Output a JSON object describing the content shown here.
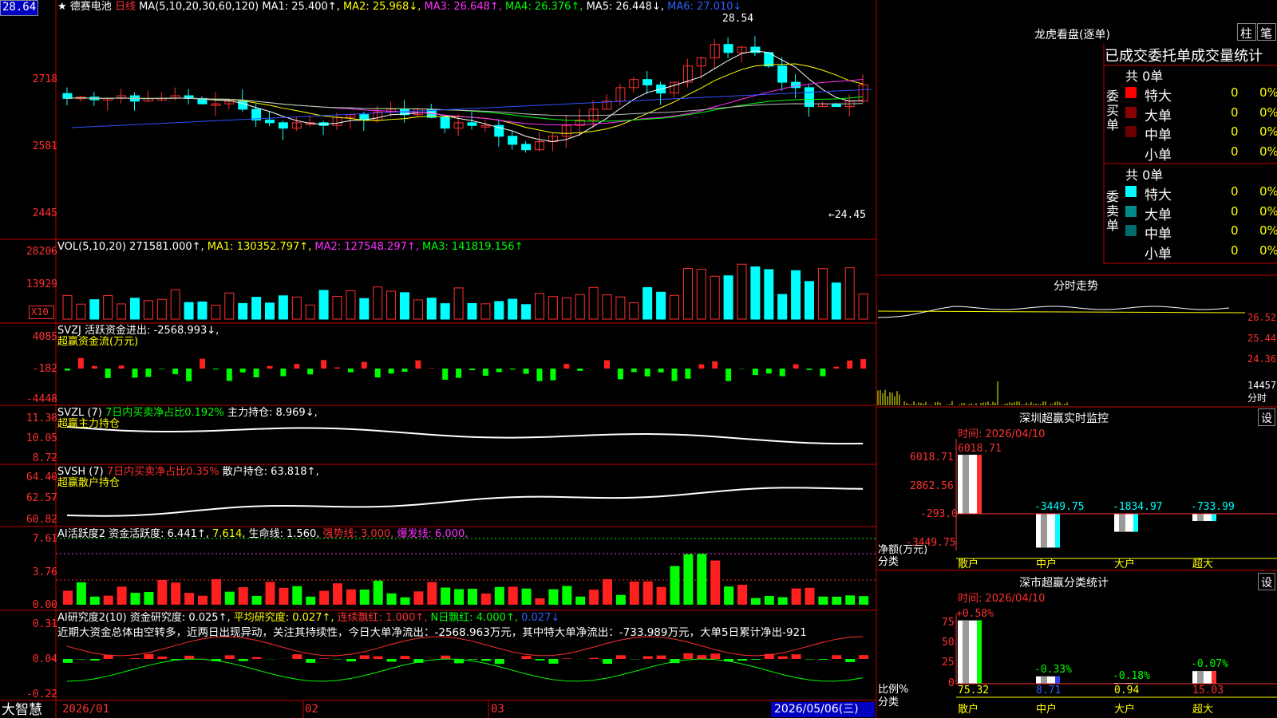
{
  "price_box": "28.64",
  "kline": {
    "header": [
      {
        "t": "★",
        "c": "wht"
      },
      {
        "t": "德赛电池",
        "c": "wht"
      },
      {
        "t": "日线",
        "c": "red"
      },
      {
        "t": "MA(5,10,20,30,60,120)",
        "c": "wht"
      },
      {
        "t": "MA1: 25.400↑,",
        "c": "wht"
      },
      {
        "t": "MA2: 25.968↓,",
        "c": "yel"
      },
      {
        "t": "MA3: 26.648↑,",
        "c": "mag"
      },
      {
        "t": "MA4: 26.376↑,",
        "c": "grn"
      },
      {
        "t": "MA5: 26.448↓,",
        "c": "wht"
      },
      {
        "t": "MA6: 27.010↓",
        "c": "blu"
      }
    ],
    "yticks": [
      "2718",
      "2581",
      "2445"
    ],
    "high_label": "28.54",
    "low_label": "←24.45",
    "chart_data": {
      "type": "candlestick",
      "series_note": "daily",
      "high": 28.54,
      "low": 24.45
    }
  },
  "vol": {
    "header": [
      {
        "t": "VOL(5,10,20)",
        "c": "wht"
      },
      {
        "t": "271581.000↑,",
        "c": "wht"
      },
      {
        "t": "MA1: 130352.797↑,",
        "c": "yel"
      },
      {
        "t": "MA2: 127548.297↑,",
        "c": "mag"
      },
      {
        "t": "MA3: 141819.156↑",
        "c": "grn"
      }
    ],
    "yticks": [
      "28206",
      "13929"
    ],
    "unit": "X10"
  },
  "svzj": {
    "header": [
      {
        "t": "SVZJ  活跃资金进出: -2568.993↓,",
        "c": "wht"
      }
    ],
    "sub": "超赢资金流(万元)",
    "yticks": [
      "4085",
      "-182",
      "-4448"
    ]
  },
  "svzl": {
    "header": [
      {
        "t": "SVZL (7)",
        "c": "wht"
      },
      {
        "t": "7日内买卖净占比0.192%",
        "c": "grn"
      },
      {
        "t": "主力持仓: 8.969↓,",
        "c": "wht"
      }
    ],
    "sub": "超赢主力持仓",
    "yticks": [
      "11.38",
      "10.05",
      "8.72"
    ]
  },
  "svsh": {
    "header": [
      {
        "t": "SVSH (7)",
        "c": "wht"
      },
      {
        "t": "7日内买卖净占比0.35%",
        "c": "red"
      },
      {
        "t": "散户持仓: 63.818↑,",
        "c": "wht"
      }
    ],
    "sub": "超赢散户持仓",
    "yticks": [
      "64.40",
      "62.57",
      "60.82"
    ]
  },
  "ai_active": {
    "header": [
      {
        "t": "AI活跃度2",
        "c": "wht"
      },
      {
        "t": "资金活跃度: 6.441↑,",
        "c": "wht"
      },
      {
        "t": "7.614,",
        "c": "yel"
      },
      {
        "t": "生命线: 1.560,",
        "c": "wht"
      },
      {
        "t": "强势线: 3.000,",
        "c": "red"
      },
      {
        "t": "爆发线: 6.000,",
        "c": "mag"
      }
    ],
    "yticks": [
      "7.61",
      "3.76",
      "0.00"
    ]
  },
  "ai_research": {
    "header": [
      {
        "t": "AI研究度2(10)",
        "c": "wht"
      },
      {
        "t": "资金研究度: 0.025↑,",
        "c": "wht"
      },
      {
        "t": "平均研究度: 0.027↑,",
        "c": "yel"
      },
      {
        "t": "连续飘红: 1.000↑,",
        "c": "red"
      },
      {
        "t": "N日飘红: 4.000↑,",
        "c": "grn"
      },
      {
        "t": "0.027↓",
        "c": "blu"
      }
    ],
    "comment": "近期大资金总体由空转多，近两日出现异动，关注其持续性，今日大单净流出：-2568.963万元，其中特大单净流出：-733.989万元，大单5日累计净出-921",
    "yticks": [
      "0.31",
      "0.04",
      "-0.22"
    ]
  },
  "bottom": {
    "logo": "大智慧",
    "dates": [
      "2026/01",
      "02",
      "03"
    ],
    "cursor_date": "2026/05/06(三)"
  },
  "right": {
    "top_title": "龙虎看盘(逐单)",
    "btn1": "柱",
    "btn2": "笔",
    "stats_title": "已成交委托单成交量统计",
    "buy": {
      "vlabel": "委买单",
      "count": "共 0单",
      "rows": [
        {
          "name": "特大",
          "color": "#ff0000",
          "val": "0",
          "pct": "0%"
        },
        {
          "name": "大单",
          "color": "#8b0000",
          "val": "0",
          "pct": "0%"
        },
        {
          "name": "中单",
          "color": "#6b0000",
          "val": "0",
          "pct": "0%"
        },
        {
          "name": "小单",
          "color": "",
          "val": "0",
          "pct": "0%"
        }
      ]
    },
    "sell": {
      "vlabel": "委卖单",
      "count": "共 0单",
      "rows": [
        {
          "name": "特大",
          "color": "#00ffff",
          "val": "0",
          "pct": "0%"
        },
        {
          "name": "大单",
          "color": "#008b8b",
          "val": "0",
          "pct": "0%"
        },
        {
          "name": "中单",
          "color": "#006b6b",
          "val": "0",
          "pct": "0%"
        },
        {
          "name": "小单",
          "color": "",
          "val": "0",
          "pct": "0%"
        }
      ]
    },
    "intraday": {
      "title": "分时走势",
      "yticks": [
        "26.52",
        "25.44",
        "24.36"
      ],
      "vol_tick": "14457",
      "vol_label": "分时"
    },
    "sz_monitor": {
      "title": "深圳超赢实时监控",
      "settings": "设",
      "time": "时间: 2026/04/10",
      "yticks": [
        "6018.71",
        "2862.56",
        "-293.0",
        "-3449.75"
      ],
      "ylabel1": "净额(万元)",
      "ylabel2": "分类",
      "chart_data": {
        "type": "bar",
        "categories": [
          "散户",
          "中户",
          "大户",
          "超大"
        ],
        "values": [
          6018.71,
          -3449.75,
          -1834.97,
          -733.99
        ],
        "labels": [
          "6018.71",
          "-3449.75",
          "-1834.97",
          "-733.99"
        ]
      }
    },
    "sz_class": {
      "title": "深市超赢分类统计",
      "settings": "设",
      "time": "时间: 2026/04/10",
      "yticks": [
        "75",
        "50",
        "25",
        "0"
      ],
      "ylabel1": "比例%",
      "ylabel2": "分类",
      "chart_data": {
        "type": "bar",
        "categories": [
          "散户",
          "中户",
          "大户",
          "超大"
        ],
        "values": [
          75.32,
          8.71,
          0.94,
          15.03
        ],
        "changes": [
          "+0.58%",
          "-0.33%",
          "-0.18%",
          "-0.07%"
        ],
        "value_labels": [
          "75.32",
          "8.71",
          "0.94",
          "15.03"
        ]
      }
    }
  }
}
